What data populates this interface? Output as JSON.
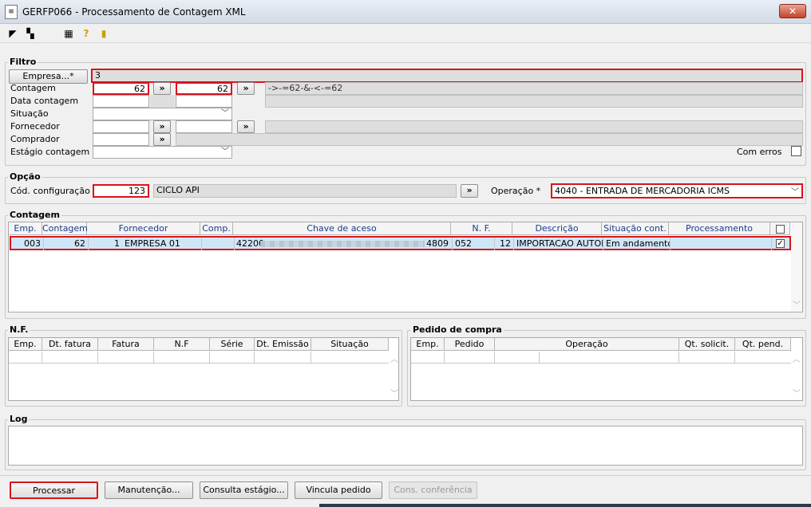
{
  "window": {
    "title": "GERFP066 - Processamento de Contagem XML",
    "close_icon": "close-icon"
  },
  "toolbar": {
    "icons": [
      "back-icon",
      "copy-icon",
      "calendar-grid-icon",
      "help-icon",
      "exit-door-icon"
    ]
  },
  "filtro": {
    "legend": "Filtro",
    "empresa_button": "Empresa...*",
    "empresa_value": "3",
    "contagem_label": "Contagem",
    "contagem_from": "62",
    "contagem_to": "62",
    "contagem_expr": "->-=62-&-<-=62",
    "data_contagem_label": "Data contagem",
    "situacao_label": "Situação",
    "fornecedor_label": "Fornecedor",
    "comprador_label": "Comprador",
    "estagio_label": "Estágio contagem",
    "com_erros_label": "Com erros",
    "arrow": "»"
  },
  "opcao": {
    "legend": "Opção",
    "cod_config_label": "Cód. configuração *",
    "cod_config_value": "123",
    "config_name": "CICLO API",
    "operacao_label": "Operação *",
    "operacao_value": "4040 - ENTRADA DE MERCADORIA ICMS"
  },
  "contagem": {
    "legend": "Contagem",
    "columns": [
      "Emp.",
      "Contagem",
      "Fornecedor",
      "Comp.",
      "Chave de aceso",
      "N. F.",
      "Descrição",
      "Situação cont.",
      "Processamento"
    ],
    "rows": [
      {
        "emp": "003",
        "contagem": "62",
        "forn_code": "1",
        "forn_name": "EMPRESA 01",
        "comp": "",
        "chave_start": "42200",
        "chave_end": "4809",
        "nf": "052",
        "nf2": "12",
        "descricao": "IMPORTACAO AUTOM.",
        "situacao": "Em andamento",
        "processamento": "",
        "checked": true
      }
    ]
  },
  "nf": {
    "legend": "N.F.",
    "columns": [
      "Emp.",
      "Dt. fatura",
      "Fatura",
      "N.F",
      "Série",
      "Dt. Emissão",
      "Situação"
    ]
  },
  "pedido": {
    "legend": "Pedido de compra",
    "columns": [
      "Emp.",
      "Pedido",
      "Operação",
      "Qt. solicit.",
      "Qt. pend."
    ]
  },
  "log": {
    "legend": "Log"
  },
  "buttons": {
    "processar": "Processar",
    "manutencao": "Manutenção...",
    "consulta": "Consulta estágio...",
    "vincula": "Vincula pedido",
    "cons_conferencia": "Cons. conferência"
  }
}
